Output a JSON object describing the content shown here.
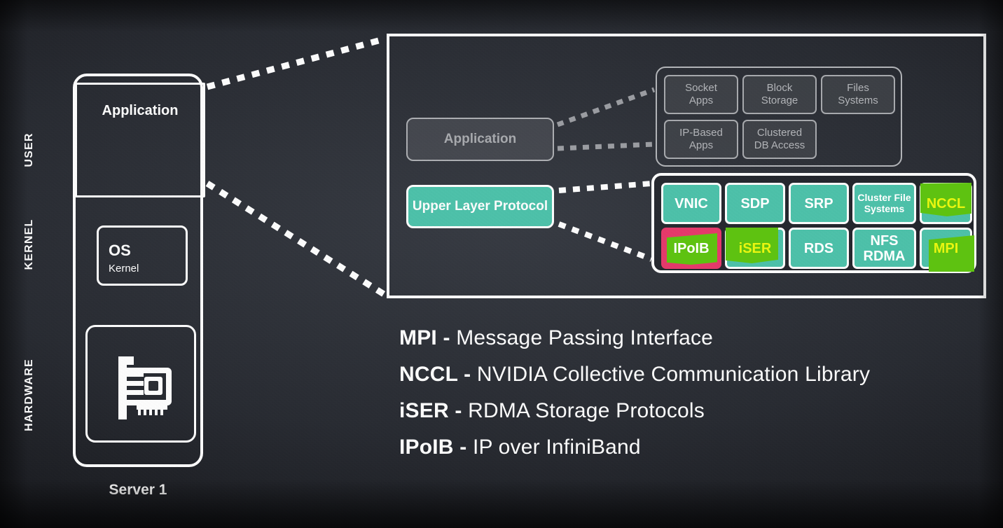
{
  "colors": {
    "background": "#23262c",
    "teal": "#4dc3ab",
    "green_highlight": "#5ec211",
    "pink_outline": "#e8396b",
    "yellow_text": "#e9f511",
    "white": "#ffffff",
    "grey_box_border": "#a9abaf",
    "grey_box_text": "#b4b6ba"
  },
  "side_labels": [
    {
      "name": "user",
      "text": "USER"
    },
    {
      "name": "kernel",
      "text": "KERNEL"
    },
    {
      "name": "hardware",
      "text": "HARDWARE"
    }
  ],
  "server_stack": {
    "application_label": "Application",
    "os_label": "OS",
    "os_sublabel": "Kernel",
    "hardware_icon": "network-interface-card-icon",
    "caption": "Server 1"
  },
  "panel": {
    "application_box": "Application",
    "upper_layer_protocol_box": "Upper Layer Protocol"
  },
  "app_types": [
    {
      "name": "socket-apps",
      "lines": [
        "Socket",
        "Apps"
      ]
    },
    {
      "name": "block-storage",
      "lines": [
        "Block",
        "Storage"
      ]
    },
    {
      "name": "files-systems",
      "lines": [
        "Files",
        "Systems"
      ]
    },
    {
      "name": "ip-based-apps",
      "lines": [
        "IP-Based",
        "Apps"
      ]
    },
    {
      "name": "clustered-db-access",
      "lines": [
        "Clustered",
        "DB Access"
      ]
    }
  ],
  "protocols": [
    {
      "name": "vnic",
      "lines": [
        "VNIC"
      ],
      "highlight": "none",
      "small": false
    },
    {
      "name": "sdp",
      "lines": [
        "SDP"
      ],
      "highlight": "none",
      "small": false
    },
    {
      "name": "srp",
      "lines": [
        "SRP"
      ],
      "highlight": "none",
      "small": false
    },
    {
      "name": "cluster-file-systems",
      "lines": [
        "Cluster File",
        "Systems"
      ],
      "highlight": "none",
      "small": true
    },
    {
      "name": "nccl",
      "lines": [
        "NCCL"
      ],
      "highlight": "green",
      "small": false
    },
    {
      "name": "ipoib",
      "lines": [
        "IPoIB"
      ],
      "highlight": "pink",
      "small": false
    },
    {
      "name": "iser",
      "lines": [
        "iSER"
      ],
      "highlight": "green",
      "small": false
    },
    {
      "name": "rds",
      "lines": [
        "RDS"
      ],
      "highlight": "none",
      "small": false
    },
    {
      "name": "nfs-rdma",
      "lines": [
        "NFS",
        "RDMA"
      ],
      "highlight": "none",
      "small": false
    },
    {
      "name": "mpi",
      "lines": [
        "MPI"
      ],
      "highlight": "green",
      "small": false
    }
  ],
  "legend": [
    {
      "abbr": "MPI",
      "dash": " - ",
      "full": "Message Passing Interface"
    },
    {
      "abbr": "NCCL",
      "dash": " - ",
      "full": "NVIDIA Collective Communication Library"
    },
    {
      "abbr": "iSER",
      "dash": " - ",
      "full": "RDMA Storage Protocols"
    },
    {
      "abbr": "IPoIB",
      "dash": " - ",
      "full": "IP over InfiniBand"
    }
  ]
}
